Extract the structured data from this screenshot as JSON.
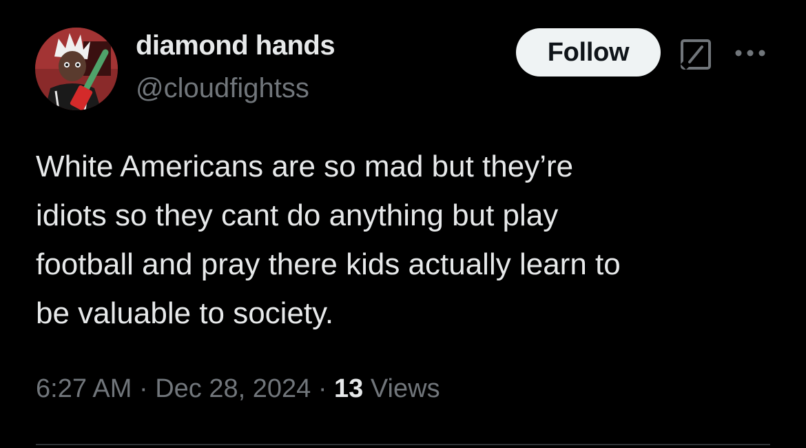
{
  "author": {
    "display_name": "diamond hands",
    "handle": "@cloudfightss"
  },
  "actions": {
    "follow_label": "Follow",
    "grok_icon": "grok-icon",
    "more_icon": "more-icon"
  },
  "tweet": {
    "text": "White Americans are so mad but they’re\nidiots so they cant do anything but play\nfootball and pray there kids actually learn to\nbe valuable to society."
  },
  "meta": {
    "time": "6:27 AM",
    "separator": " · ",
    "date": "Dec 28, 2024",
    "views_count": "13",
    "views_label": "Views"
  },
  "colors": {
    "background": "#000000",
    "primary_text": "#e7e9ea",
    "secondary_text": "#71767b",
    "follow_button_bg": "#eff3f4",
    "follow_button_text": "#0f1419",
    "divider": "#2f3336"
  }
}
